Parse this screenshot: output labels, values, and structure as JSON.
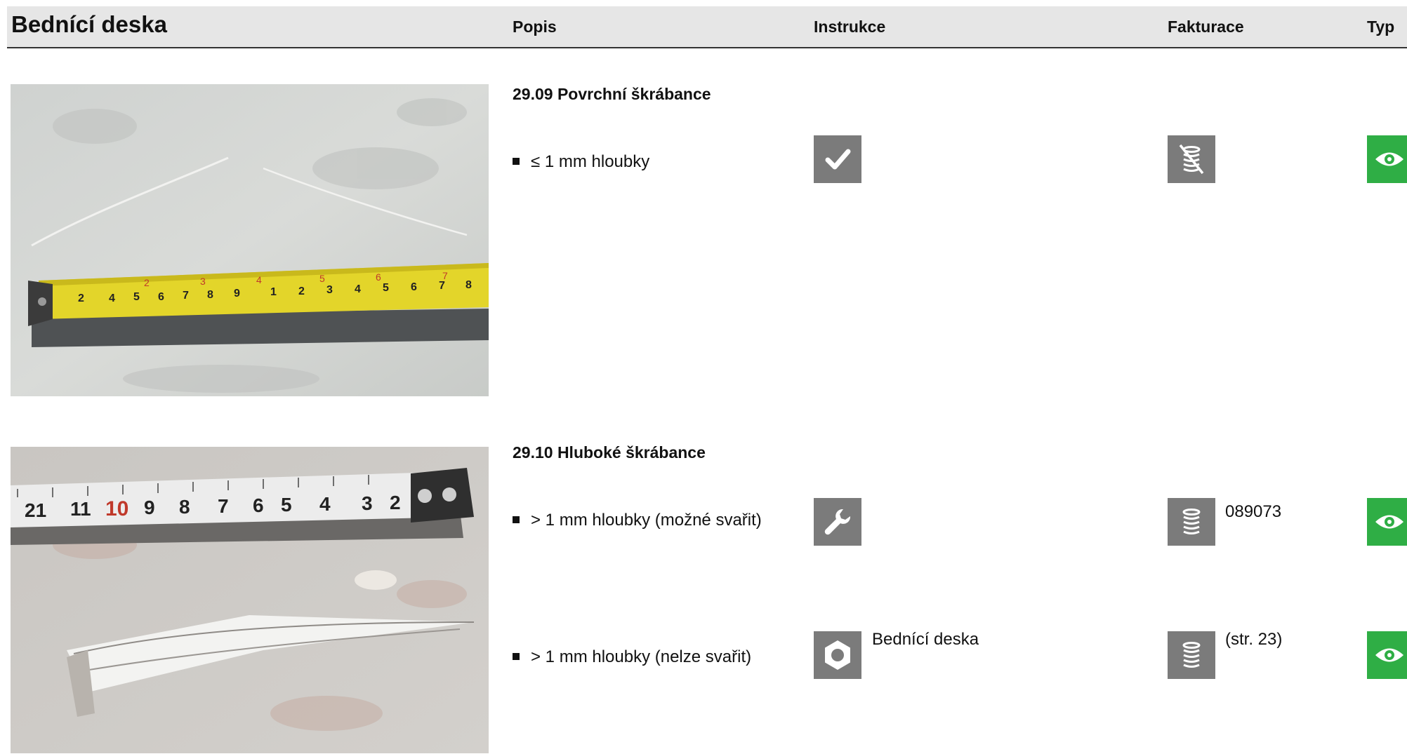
{
  "header": {
    "title": "Bednící deska",
    "col_popis": "Popis",
    "col_instrukce": "Instrukce",
    "col_fakturace": "Fakturace",
    "col_typ": "Typ"
  },
  "items": [
    {
      "title": "29.09 Povrchní škrábance",
      "rows": [
        {
          "text": "≤ 1 mm hloubky",
          "instruction_icon": "checkmark-icon",
          "instruction_text": "",
          "billing_icon": "no-coins-icon",
          "billing_text": "",
          "type_icon": "eye-icon"
        }
      ]
    },
    {
      "title": "29.10 Hluboké škrábance",
      "rows": [
        {
          "text": "> 1 mm hloubky (možné svařit)",
          "instruction_icon": "wrench-icon",
          "instruction_text": "",
          "billing_icon": "coins-icon",
          "billing_text": "089073",
          "type_icon": "eye-icon"
        },
        {
          "text": "> 1 mm hloubky (nelze svařit)",
          "instruction_icon": "hex-nut-icon",
          "instruction_text": "Bednící deska",
          "billing_icon": "coins-icon",
          "billing_text": "(str. 23)",
          "type_icon": "eye-icon"
        }
      ]
    }
  ],
  "colors": {
    "header_bg": "#e6e6e6",
    "icon_bg": "#7b7b7b",
    "eye_bg": "#2fae45"
  }
}
